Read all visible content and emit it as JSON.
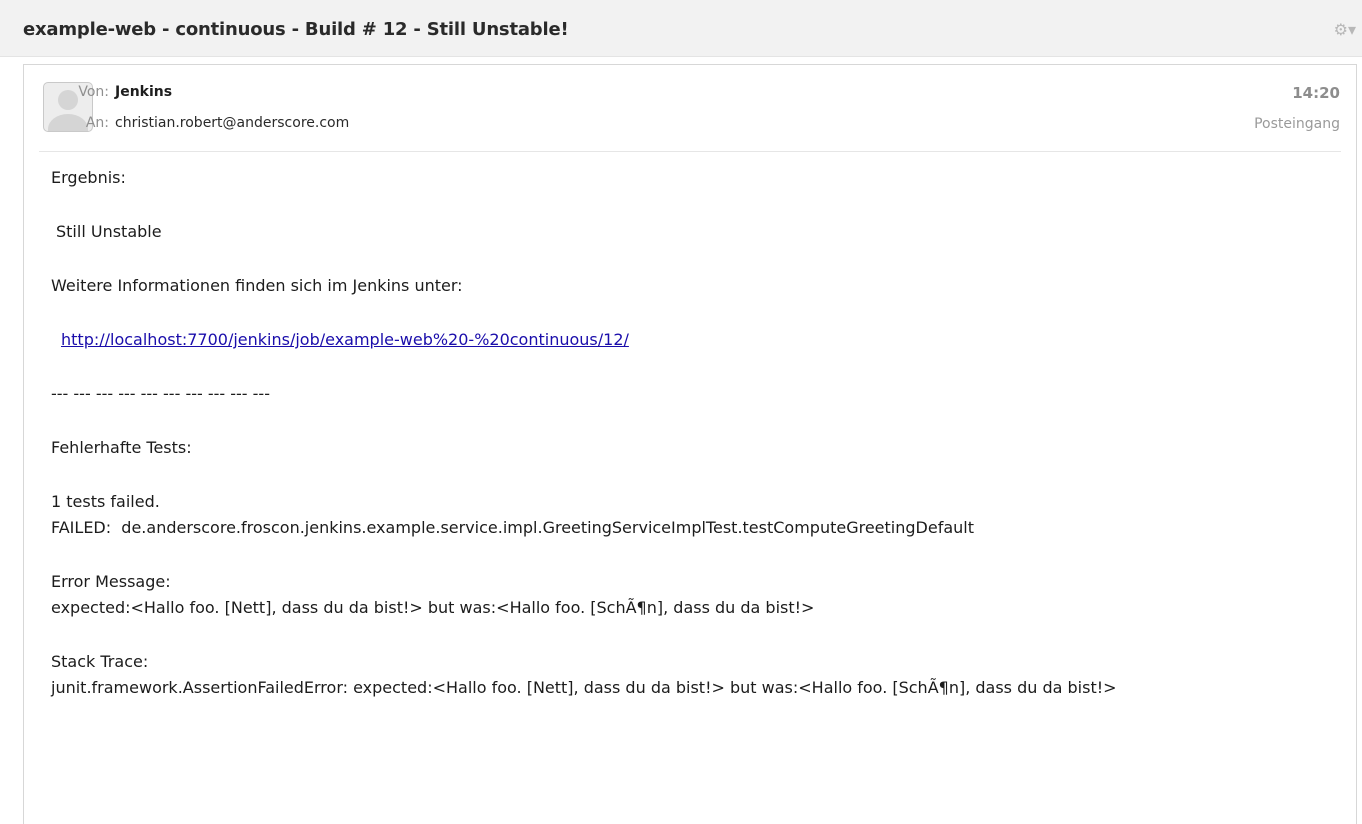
{
  "header_bar": {
    "subject": "example-web - continuous - Build # 12 - Still Unstable!",
    "settings_glyph": "⚙▾",
    "settings_icon": "gear-icon"
  },
  "message": {
    "from_label": "Von:",
    "from_name": "Jenkins",
    "to_label": "An:",
    "to_address": "christian.robert@anderscore.com",
    "time": "14:20",
    "folder": "Posteingang",
    "avatar_icon": "person-avatar-icon"
  },
  "body": {
    "result_heading": "Ergebnis:",
    "result_value": "Still Unstable",
    "info_text": "Weitere Informationen finden sich im Jenkins unter:",
    "link_url": "http://localhost:7700/jenkins/job/example-web%20-%20continuous/12/",
    "separator": "--- --- --- --- --- --- --- --- --- ---",
    "failed_tests_heading": "Fehlerhafte Tests:",
    "tests_failed_count": "1 tests failed.",
    "failed_test": "FAILED:  de.anderscore.froscon.jenkins.example.service.impl.GreetingServiceImplTest.testComputeGreetingDefault",
    "error_message_heading": "Error Message:",
    "error_message": "expected:<Hallo foo. [Nett], dass du da bist!> but was:<Hallo foo. [SchÃ¶n], dass du da bist!>",
    "stack_trace_heading": "Stack Trace:",
    "stack_trace": "junit.framework.AssertionFailedError: expected:<Hallo foo. [Nett], dass du da bist!> but was:<Hallo foo. [SchÃ¶n], dass du da bist!>"
  },
  "colors": {
    "link": "#1a0dab",
    "header_bar_bg": "#f2f2f2",
    "muted_text": "#8f8f8f"
  }
}
